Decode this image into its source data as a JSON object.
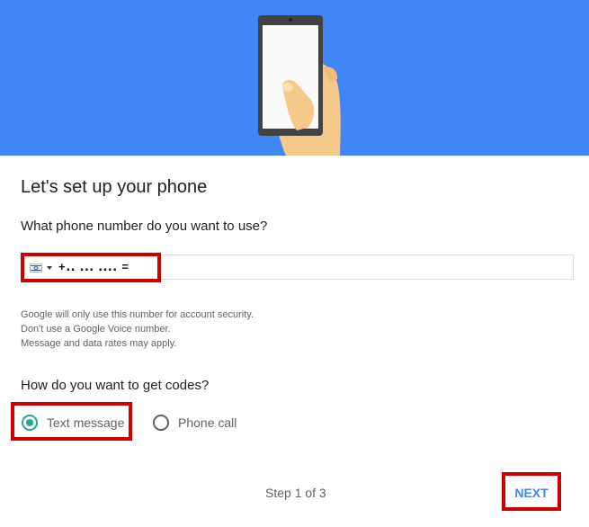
{
  "colors": {
    "hero_bg": "#4285f4",
    "accent_teal": "#26a69a",
    "link_blue": "#4285f4",
    "highlight_red": "#cc0000"
  },
  "hero": {
    "illustration": "hand-holding-phone"
  },
  "title": "Let's set up your phone",
  "phone_question": "What phone number do you want to use?",
  "phone_input": {
    "country_icon": "israel-flag-icon",
    "value": "+․․ ․․․ ․․․․ ="
  },
  "help_lines": [
    "Google will only use this number for account security.",
    "Don't use a Google Voice number.",
    "Message and data rates may apply."
  ],
  "codes_question": "How do you want to get codes?",
  "code_options": [
    {
      "label": "Text message",
      "selected": true
    },
    {
      "label": "Phone call",
      "selected": false
    }
  ],
  "step_text": "Step 1 of 3",
  "next_label": "NEXT"
}
